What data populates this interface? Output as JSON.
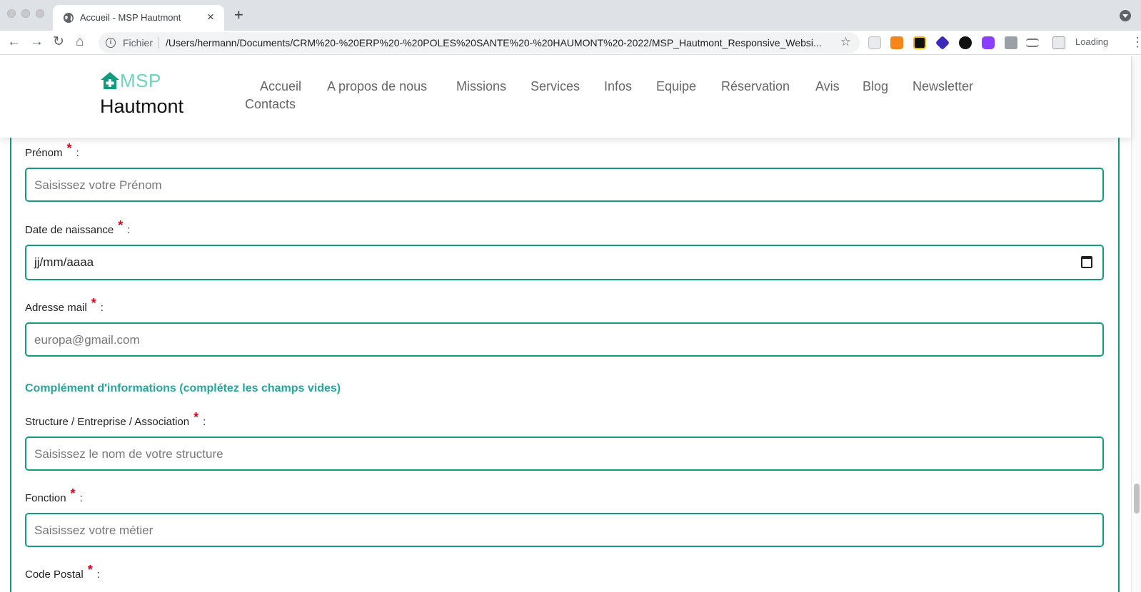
{
  "browser": {
    "tab_title": "Accueil - MSP Hautmont",
    "tab_close": "×",
    "new_tab": "+",
    "scheme_label": "Fichier",
    "url": "/Users/hermann/Documents/CRM%20-%20ERP%20-%20POLES%20SANTE%20-%20HAUMONT%20-2022/MSP_Hautmont_Responsive_Websi...",
    "loading_label": "Loading",
    "back": "←",
    "forward": "→",
    "reload": "↻",
    "home": "⌂",
    "star": "☆",
    "kebab": "⋮"
  },
  "site": {
    "logo_msp": "MSP",
    "logo_name": "Hautmont",
    "brand_color": "#139b7d",
    "nav": [
      "Accueil",
      "A propos de nous",
      "Missions",
      "Services",
      "Infos",
      "Equipe",
      "Réservation",
      "Avis",
      "Blog",
      "Newsletter",
      "Contacts"
    ]
  },
  "form": {
    "required_mark": "*",
    "colon": ":",
    "prenom": {
      "label": "Prénom",
      "placeholder": "Saisissez votre Prénom"
    },
    "date": {
      "label": "Date de naissance",
      "value": "jj/mm/aaaa"
    },
    "email": {
      "label": "Adresse mail",
      "placeholder": "europa@gmail.com"
    },
    "section_title": "Complément d'informations (complétez les champs vides)",
    "structure": {
      "label": "Structure / Entreprise / Association",
      "placeholder": "Saisissez le nom de votre structure"
    },
    "fonction": {
      "label": "Fonction",
      "placeholder": "Saisissez votre métier"
    },
    "code_postal": {
      "label": "Code Postal"
    }
  }
}
